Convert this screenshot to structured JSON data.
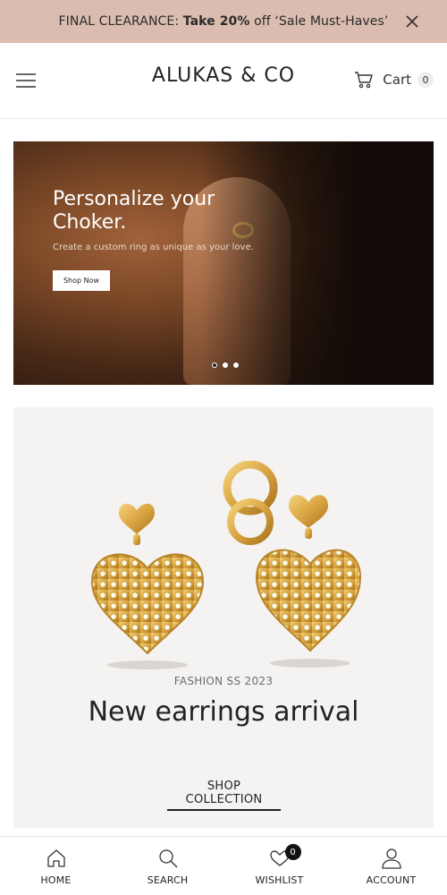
{
  "promo": {
    "prefix": "FINAL CLEARANCE: ",
    "highlight": "Take 20%",
    "suffix": " off ‘Sale Must-Haves’",
    "close_icon": "close-icon"
  },
  "header": {
    "menu_icon": "hamburger-menu-icon",
    "brand": "ALUKAS & CO",
    "cart_label": "Cart",
    "cart_count": "0",
    "cart_icon": "cart-icon"
  },
  "hero": {
    "title": "Personalize your Choker.",
    "subtitle": "Create a custom ring as unique as your love.",
    "button_label": "Shop Now",
    "slides": 3,
    "active_slide": 1
  },
  "collection": {
    "kicker": "FASHION SS 2023",
    "title": "New earrings arrival",
    "link_label": "SHOP COLLECTION"
  },
  "bottom_nav": {
    "items": [
      {
        "label": "HOME",
        "icon": "home-icon"
      },
      {
        "label": "SEARCH",
        "icon": "search-icon"
      },
      {
        "label": "WISHLIST",
        "icon": "heart-icon",
        "badge": "0"
      },
      {
        "label": "ACCOUNT",
        "icon": "user-icon"
      }
    ]
  },
  "colors": {
    "promo_bg": "#dbbcb0",
    "card_bg": "#f4f3f2",
    "gold": "#d9a441"
  }
}
